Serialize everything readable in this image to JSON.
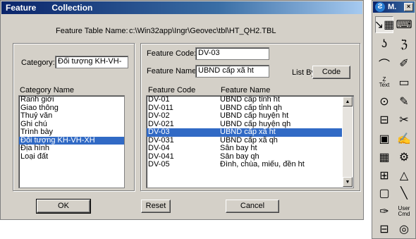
{
  "dialog": {
    "title_left": "Feature",
    "title_right": "Collection",
    "feature_table_name_label": "Feature Table Name:",
    "feature_table_name_value": "c:\\Win32app\\Ingr\\Geovec\\tbl\\HT_QH2.TBL",
    "category_label": "Category:",
    "category_value": "Đối tượng KH-VH-",
    "category_name_header": "Category Name",
    "categories": [
      "Ranh giới",
      "Giao thông",
      "Thuỷ văn",
      "Ghi chú",
      "Trình bày",
      "Đối tượng KH-VH-XH",
      "Địa hình",
      "Loại đất"
    ],
    "selected_category_index": 5,
    "feature_code_label": "Feature  Code:",
    "feature_code_value": "DV-03",
    "feature_name_label": "Feature Name:",
    "feature_name_value": "UBND cấp xã ht",
    "list_by_label": "List By",
    "list_by_button": "Code",
    "feature_code_header": "Feature Code",
    "feature_name_header": "Feature Name",
    "features": [
      {
        "code": "DV-01",
        "name": "UBND cấp tỉnh ht"
      },
      {
        "code": "DV-011",
        "name": "UBND cấp tỉnh qh"
      },
      {
        "code": "DV-02",
        "name": "UBND cấp huyện ht"
      },
      {
        "code": "DV-021",
        "name": "UBND cấp huyện qh"
      },
      {
        "code": "DV-03",
        "name": "UBND cấp xã ht"
      },
      {
        "code": "DV-031",
        "name": "UBND cấp xã qh"
      },
      {
        "code": "DV-04",
        "name": "Sân bay ht"
      },
      {
        "code": "DV-041",
        "name": "Sân bay qh"
      },
      {
        "code": "DV-05",
        "name": "Đình, chùa, miếu, đền ht"
      }
    ],
    "selected_feature_index": 4,
    "ok_button": "OK",
    "reset_button": "Reset",
    "cancel_button": "Cancel"
  },
  "palette": {
    "title": "M.",
    "close": "×",
    "user_cmd_line1": "User",
    "user_cmd_line2": "Cmd",
    "text_tool": "Text",
    "tools": [
      "select-arrow",
      "grid-dialog",
      "curve-arc",
      "curve-branch",
      "polyline",
      "pen-draw",
      "text-place",
      "rectangle",
      "circle-point",
      "pen-edit",
      "node-edit",
      "line-cut",
      "select-area",
      "pen-fill",
      "grid-view",
      "feature-attribute",
      "node-move",
      "triangle-edit",
      "window-frame",
      "line-draw",
      "pen-user",
      "user-command",
      "save-disk",
      "target-rings"
    ]
  }
}
